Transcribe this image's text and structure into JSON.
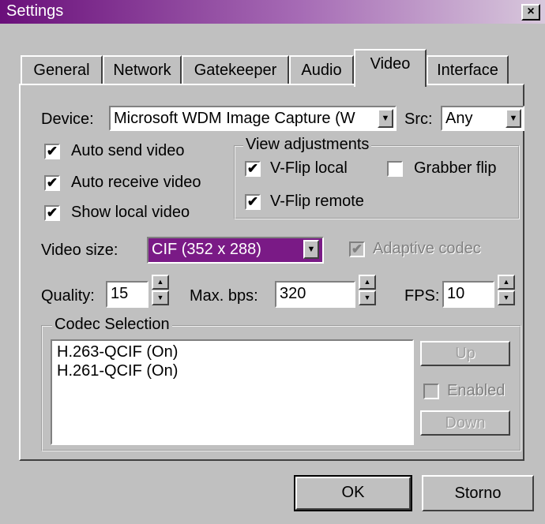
{
  "window": {
    "title": "Settings",
    "close_glyph": "×"
  },
  "tabs": [
    {
      "label": "General"
    },
    {
      "label": "Network"
    },
    {
      "label": "Gatekeeper"
    },
    {
      "label": "Audio"
    },
    {
      "label": "Video",
      "active": true
    },
    {
      "label": "Interface"
    }
  ],
  "device": {
    "label": "Device:",
    "value": "Microsoft WDM Image Capture (W",
    "src_label": "Src:",
    "src_value": "Any"
  },
  "checks": {
    "auto_send": {
      "label": "Auto send video",
      "checked": true
    },
    "auto_receive": {
      "label": "Auto receive video",
      "checked": true
    },
    "show_local": {
      "label": "Show local video",
      "checked": true
    }
  },
  "view_adjustments": {
    "legend": "View adjustments",
    "vflip_local": {
      "label": "V-Flip local",
      "checked": true
    },
    "grabber_flip": {
      "label": "Grabber flip",
      "checked": false
    },
    "vflip_remote": {
      "label": "V-Flip remote",
      "checked": true
    }
  },
  "video_size": {
    "label": "Video size:",
    "value": "CIF (352 x 288)",
    "highlight": "#7a1a86"
  },
  "adaptive_codec": {
    "label": "Adaptive codec",
    "checked": true,
    "disabled": true
  },
  "quality": {
    "label": "Quality:",
    "value": "15"
  },
  "max_bps": {
    "label": "Max. bps:",
    "value": "320"
  },
  "fps": {
    "label": "FPS:",
    "value": "10"
  },
  "codec_selection": {
    "legend": "Codec Selection",
    "items": [
      "H.263-QCIF (On)",
      "H.261-QCIF (On)"
    ],
    "up_label": "Up",
    "enabled_label": "Enabled",
    "down_label": "Down"
  },
  "footer": {
    "ok_label": "OK",
    "cancel_label": "Storno"
  },
  "glyphs": {
    "check": "✔",
    "down_arrow": "▼",
    "up_arrow": "▲"
  }
}
